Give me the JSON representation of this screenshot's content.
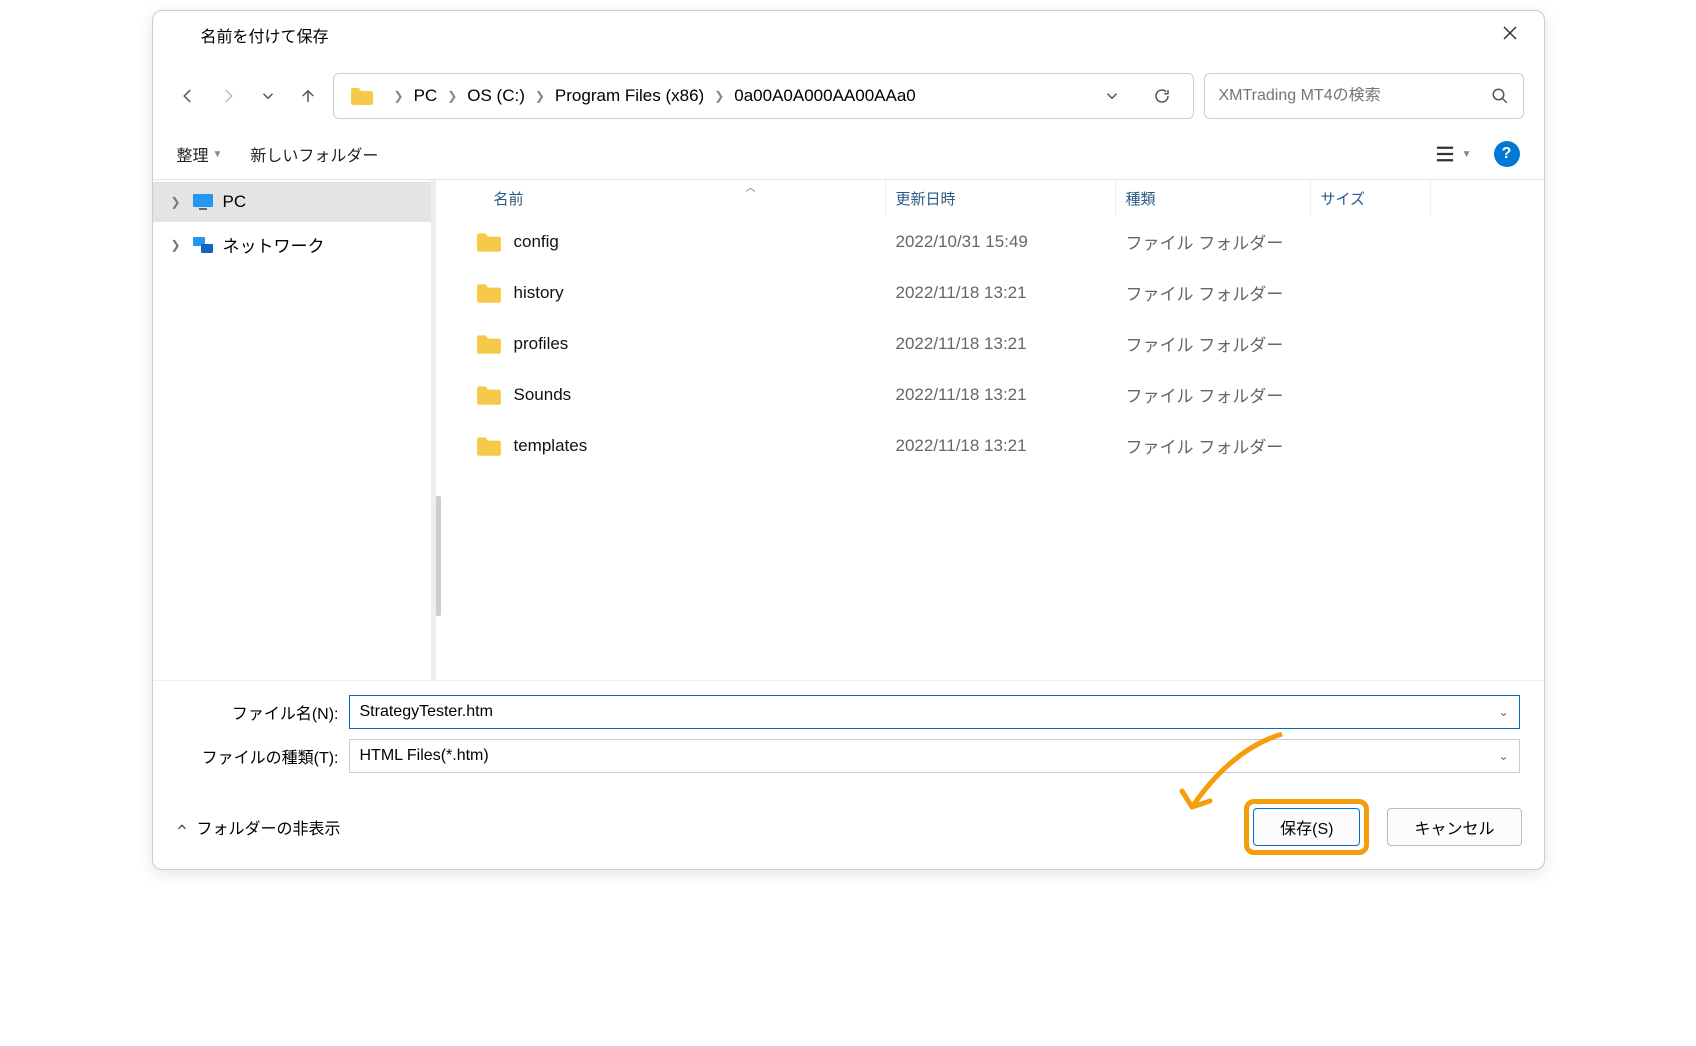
{
  "title": "名前を付けて保存",
  "breadcrumbs": [
    "PC",
    "OS (C:)",
    "Program Files (x86)",
    "0a00A0A000AA00AAa0"
  ],
  "search_placeholder": "XMTrading MT4の検索",
  "toolbar": {
    "organize": "整理",
    "new_folder": "新しいフォルダー"
  },
  "sidebar": {
    "items": [
      {
        "label": "PC",
        "selected": true,
        "icon": "pc"
      },
      {
        "label": "ネットワーク",
        "selected": false,
        "icon": "network"
      }
    ]
  },
  "columns": {
    "name": "名前",
    "date": "更新日時",
    "type": "種類",
    "size": "サイズ"
  },
  "files": [
    {
      "name": "config",
      "date": "2022/10/31 15:49",
      "type": "ファイル フォルダー"
    },
    {
      "name": "history",
      "date": "2022/11/18 13:21",
      "type": "ファイル フォルダー"
    },
    {
      "name": "profiles",
      "date": "2022/11/18 13:21",
      "type": "ファイル フォルダー"
    },
    {
      "name": "Sounds",
      "date": "2022/11/18 13:21",
      "type": "ファイル フォルダー"
    },
    {
      "name": "templates",
      "date": "2022/11/18 13:21",
      "type": "ファイル フォルダー"
    }
  ],
  "bottom": {
    "filename_label": "ファイル名(N):",
    "filename_value": "StrategyTester.htm",
    "filetype_label": "ファイルの種類(T):",
    "filetype_value": "HTML Files(*.htm)"
  },
  "footer": {
    "hide_folders": "フォルダーの非表示",
    "save": "保存(S)",
    "cancel": "キャンセル"
  }
}
